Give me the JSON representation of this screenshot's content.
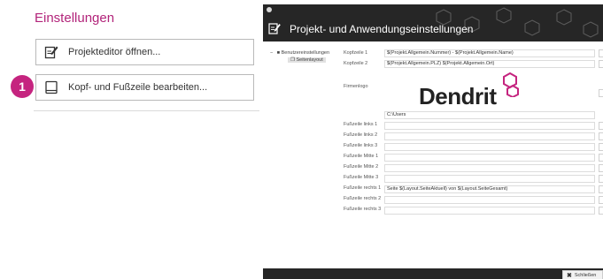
{
  "left_panel": {
    "title": "Einstellungen",
    "buttons": [
      {
        "label": "Projekteditor öffnen...",
        "icon": "edit-document-icon"
      },
      {
        "label": "Kopf- und Fußzeile bearbeiten...",
        "icon": "tablet-icon"
      }
    ],
    "step_badge": "1",
    "accent_color": "#c5247f"
  },
  "dialog": {
    "title": "Projekt- und Anwendungseinstellungen",
    "tree": {
      "root": "Benutzereinstellungen",
      "child": "Seitenlayout"
    },
    "fields": [
      {
        "label": "Kopfzeile 1",
        "value": "$(Projekt.Allgemein.Nummer) - $(Projekt.Allgemein.Name)"
      },
      {
        "label": "Kopfzeile 2",
        "value": "$(Projekt.Allgemein.PLZ) $(Projekt.Allgemein.Ort)"
      },
      {
        "label": "Firmenlogo",
        "value": ""
      },
      {
        "label": "",
        "value": "C:\\Users"
      },
      {
        "label": "Fußzeile links 1",
        "value": ""
      },
      {
        "label": "Fußzeile links 2",
        "value": ""
      },
      {
        "label": "Fußzeile links 3",
        "value": ""
      },
      {
        "label": "Fußzeile Mitte 1",
        "value": ""
      },
      {
        "label": "Fußzeile Mitte 2",
        "value": ""
      },
      {
        "label": "Fußzeile Mitte 3",
        "value": ""
      },
      {
        "label": "Fußzeile rechts 1",
        "value": "Seite $(Layout.SeiteAktuell) von $(Layout.SeiteGesamt)"
      },
      {
        "label": "Fußzeile rechts 2",
        "value": ""
      },
      {
        "label": "Fußzeile rechts 3",
        "value": ""
      }
    ],
    "logo_text": "Dendrit",
    "close_label": "Schließen",
    "header_color": "#262626"
  }
}
